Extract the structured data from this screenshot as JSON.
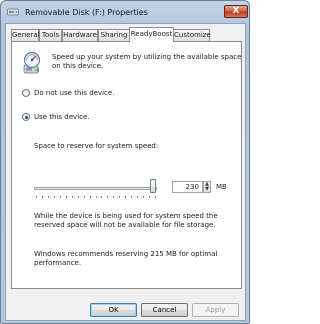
{
  "window": {
    "title": "Removable Disk (F:) Properties",
    "close_label": "X"
  },
  "tabs": [
    {
      "label": "General"
    },
    {
      "label": "Tools"
    },
    {
      "label": "Hardware"
    },
    {
      "label": "Sharing"
    },
    {
      "label": "ReadyBoost",
      "active": true
    },
    {
      "label": "Customize"
    }
  ],
  "readyboost": {
    "intro_line1": "Speed up your system by utilizing the available space",
    "intro_line2": "on this device.",
    "option_no": "Do not use this device.",
    "option_use": "Use this device.",
    "selected_option": "use",
    "reserve_label": "Space to reserve for system speed:",
    "reserve_value": "230",
    "reserve_unit": "MB",
    "slider_level_fraction": 0.97,
    "info_line1": "While the device is being used for system speed the",
    "info_line2": "reserved space will not be available for file storage.",
    "recommend_line1": "Windows recommends reserving 215 MB for optimal",
    "recommend_line2": "performance."
  },
  "buttons": {
    "ok": "OK",
    "cancel": "Cancel",
    "apply": "Apply"
  },
  "icons": {
    "title_icon": "removable-disk-icon",
    "readyboost_icon": "readyboost-gauge-icon"
  },
  "colors": {
    "accent": "#1f4f9c",
    "close_button": "#cf5d3e"
  }
}
